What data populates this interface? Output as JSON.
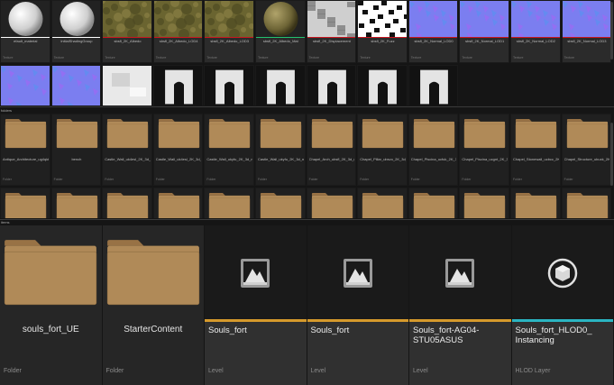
{
  "sections": {
    "folders_header": "folders",
    "items_header": "items"
  },
  "row1": [
    {
      "label": "efault_material",
      "type": "Texture",
      "kind": "sphere-white",
      "stripe": "#ffffff"
    },
    {
      "label": "InitialShadingGroup",
      "type": "Texture",
      "kind": "sphere-white",
      "stripe": "#ffffff"
    },
    {
      "label": "sbsfl_2K_Albedo",
      "type": "Texture",
      "kind": "albedo",
      "stripe": "#c8151f"
    },
    {
      "label": "sbsfl_2K_Albedo_LOD4",
      "type": "Texture",
      "kind": "albedo",
      "stripe": "#c8151f"
    },
    {
      "label": "sbsfl_2K_Albedo_LOD3",
      "type": "Texture",
      "kind": "albedo",
      "stripe": "#c8151f"
    },
    {
      "label": "sbsfl_2K_Albedo_Mat",
      "type": "Texture",
      "kind": "sphere-moss",
      "stripe": "#22c06e"
    },
    {
      "label": "sbsfl_2K_Displacement",
      "type": "Texture",
      "kind": "displacement",
      "stripe": "#c8151f"
    },
    {
      "label": "sbsfl_2K_Fuzz",
      "type": "Texture",
      "kind": "fuzz",
      "stripe": "#c8151f"
    },
    {
      "label": "sbsfl_2K_Normal_LOD0",
      "type": "Texture",
      "kind": "normal",
      "stripe": "#c8151f"
    },
    {
      "label": "sbsfl_2K_Normal_LOD1",
      "type": "Texture",
      "kind": "normal",
      "stripe": "#c8151f"
    },
    {
      "label": "sbsfl_2K_Normal_LOD2",
      "type": "Texture",
      "kind": "normal",
      "stripe": "#c8151f"
    },
    {
      "label": "sbsfl_2K_Normal_LOD3",
      "type": "Texture",
      "kind": "normal",
      "stripe": "#c8151f"
    }
  ],
  "row2": [
    {
      "label": "",
      "type": "",
      "kind": "normal"
    },
    {
      "label": "",
      "type": "",
      "kind": "normal"
    },
    {
      "label": "",
      "type": "",
      "kind": "white"
    },
    {
      "label": "",
      "type": "",
      "kind": "mesh"
    },
    {
      "label": "",
      "type": "",
      "kind": "mesh"
    },
    {
      "label": "",
      "type": "",
      "kind": "mesh"
    },
    {
      "label": "",
      "type": "",
      "kind": "mesh"
    },
    {
      "label": "",
      "type": "",
      "kind": "mesh"
    },
    {
      "label": "",
      "type": "",
      "kind": "mesh"
    }
  ],
  "folders_row1": [
    {
      "label": "Antique_Architecture_ug4qkfdv_2K_3d_ms",
      "type": "Folder"
    },
    {
      "label": "bench",
      "type": "Folder"
    },
    {
      "label": "Castle_Wall_uk4esl_2K_3d_ms",
      "type": "Folder"
    },
    {
      "label": "Castle_Wall_uk4esl_2K_3d_ms",
      "type": "Folder"
    },
    {
      "label": "Castle_Wall_ukyfu_2K_3d_ms",
      "type": "Folder"
    },
    {
      "label": "Castle_Wall_ukyfu_2K_3d_ms",
      "type": "Folder"
    },
    {
      "label": "Chapel_Arch_ubsfl_2K_3d_ms",
      "type": "Folder"
    },
    {
      "label": "Chapel_Pillar_ubsvo_2K_3d_ms",
      "type": "Folder"
    },
    {
      "label": "Chapel_Piscina_ucfuk_2K_3d_ms",
      "type": "Folder"
    },
    {
      "label": "Chapel_Piscina_ucgnt_2K_3d_ms",
      "type": "Folder"
    },
    {
      "label": "Chapel_Stonewall_ucbcc_2K_3d_ms",
      "type": "Folder"
    },
    {
      "label": "Chapel_Structure_ubuxk_2K_3d_ms",
      "type": "Folder"
    }
  ],
  "folders_row2_count_label": "Folder",
  "big_tiles": [
    {
      "label": "souls_fort_UE",
      "type": "Folder",
      "kind": "folder"
    },
    {
      "label": "StarterContent",
      "type": "Folder",
      "kind": "folder"
    },
    {
      "label": "Souls_fort",
      "type": "Level",
      "kind": "level",
      "stripe": "#d69a2c"
    },
    {
      "label": "Souls_fort",
      "type": "Level",
      "kind": "level",
      "stripe": "#d69a2c"
    },
    {
      "label": "Souls_fort-AG04-STU05ASUS",
      "type": "Level",
      "kind": "level",
      "stripe": "#d69a2c"
    },
    {
      "label": "Souls_fort_HLOD0_ Instancing",
      "type": "HLOD Layer",
      "kind": "hlod",
      "stripe": "#2bb5c2"
    }
  ],
  "colors": {
    "folder_body": "#b08a58",
    "folder_tab": "#987245",
    "texture_stripe": "#c8151f",
    "level_stripe": "#d69a2c",
    "hlod_stripe": "#2bb5c2"
  }
}
